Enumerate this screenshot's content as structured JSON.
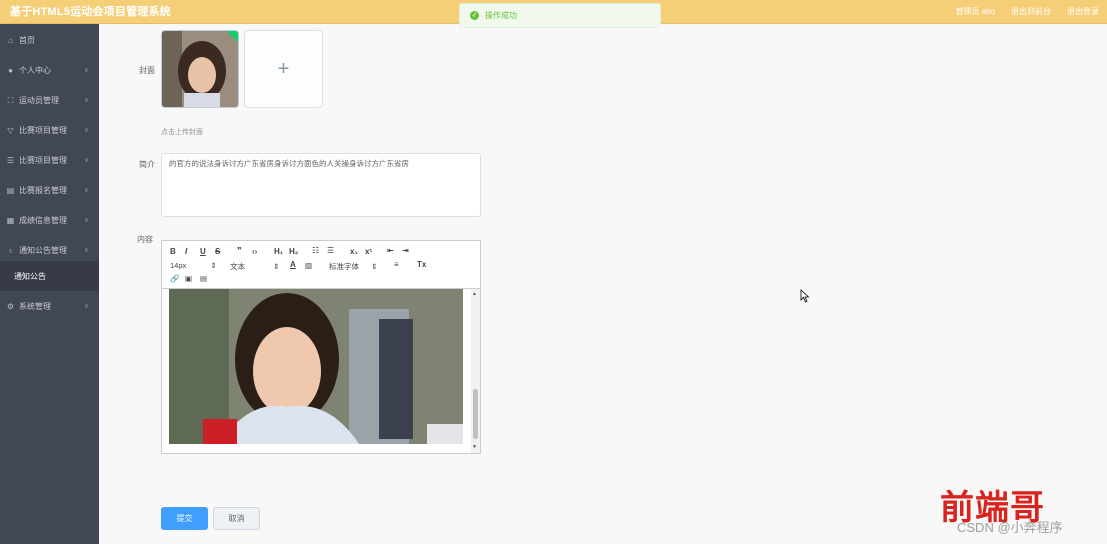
{
  "header": {
    "title": "基于HTML5运动会项目管理系统",
    "right_items": [
      "管理员 abo",
      "退出到前台",
      "退出登录"
    ]
  },
  "toast": {
    "message": "操作成功"
  },
  "sidebar": {
    "items": [
      {
        "label": "首页",
        "icon": "home-icon"
      },
      {
        "label": "个人中心",
        "icon": "user-icon"
      },
      {
        "label": "运动员管理",
        "icon": "fullscreen-icon"
      },
      {
        "label": "比赛项目管理",
        "icon": "trophy-icon"
      },
      {
        "label": "比赛项目管理",
        "icon": "sliders-icon"
      },
      {
        "label": "比赛报名管理",
        "icon": "database-icon"
      },
      {
        "label": "成绩信息管理",
        "icon": "list-icon"
      },
      {
        "label": "通知公告管理",
        "icon": "bell-icon"
      },
      {
        "label": "系统管理",
        "icon": "gear-icon"
      }
    ],
    "active_sub": "通知公告"
  },
  "form": {
    "cover_label": "封面",
    "upload_hint": "点击上传封面",
    "intro_label": "简介",
    "intro_value": "的官方的说法身诉讨方广东省房身诉讨方面色的人关操身诉讨方广东省房",
    "content_label": "内容",
    "editor": {
      "font_size": "14px",
      "block": "文本",
      "font_family": "标准字体"
    },
    "submit_label": "提交",
    "cancel_label": "取消"
  },
  "watermark": {
    "big": "前端哥",
    "small": "CSDN @小奔程序"
  },
  "colors": {
    "header": "#f5cf78",
    "sidebar": "#424756",
    "primary": "#409eff",
    "success": "#67c23a"
  }
}
